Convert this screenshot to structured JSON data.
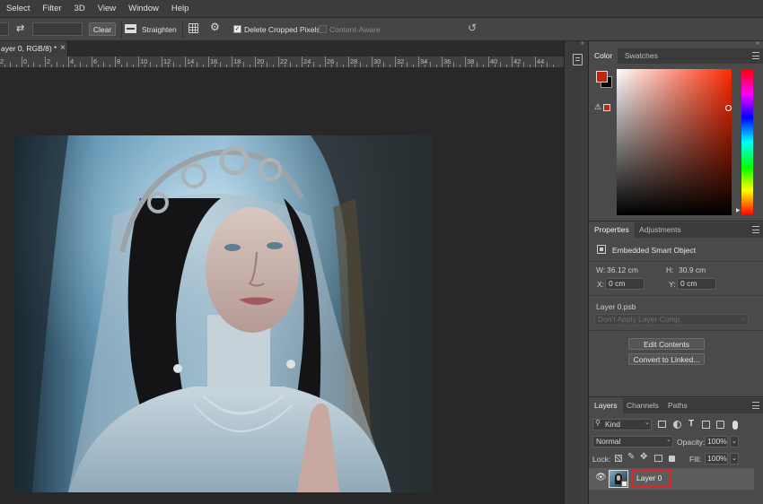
{
  "menu": [
    "Select",
    "Filter",
    "3D",
    "View",
    "Window",
    "Help"
  ],
  "options": {
    "clear_label": "Clear",
    "straighten_label": "Straighten",
    "delete_cropped_label": "Delete Cropped Pixels",
    "delete_cropped_checked": true,
    "content_aware_label": "Content-Aware",
    "content_aware_checked": false
  },
  "document": {
    "tab_title": "ayer 0, RGB/8) *",
    "close_glyph": "×",
    "ruler_labels": [
      "2",
      "0",
      "2",
      "4",
      "6",
      "8",
      "10",
      "12",
      "14",
      "16",
      "18",
      "20",
      "22",
      "24",
      "26",
      "28",
      "30",
      "32",
      "34",
      "36",
      "38",
      "40",
      "42",
      "44"
    ]
  },
  "color_panel": {
    "tabs": [
      "Color",
      "Swatches"
    ],
    "active_tab": "Color",
    "foreground": "#c0250e",
    "background": "#000000",
    "gamut_swatch": "#c0250e",
    "hue": "#ff2a00"
  },
  "properties_panel": {
    "tabs": [
      "Properties",
      "Adjustments"
    ],
    "active_tab": "Properties",
    "object_type": "Embedded Smart Object",
    "w_label": "W:",
    "w_value": "36.12 cm",
    "h_label": "H:",
    "h_value": "30.9 cm",
    "x_label": "X:",
    "x_value": "0 cm",
    "y_label": "Y:",
    "y_value": "0 cm",
    "linked_file": "Layer 0.psb",
    "layer_comp": "Don't Apply Layer Comp",
    "edit_contents_label": "Edit Contents",
    "convert_label": "Convert to Linked..."
  },
  "layers_panel": {
    "tabs": [
      "Layers",
      "Channels",
      "Paths"
    ],
    "active_tab": "Layers",
    "filter_kind": "Kind",
    "blend_mode": "Normal",
    "opacity_label": "Opacity:",
    "opacity_value": "100%",
    "lock_label": "Lock:",
    "fill_label": "Fill:",
    "fill_value": "100%",
    "layers": [
      {
        "name": "Layer 0",
        "visible": true,
        "selected": true
      }
    ],
    "highlight_color": "#e8202a"
  }
}
